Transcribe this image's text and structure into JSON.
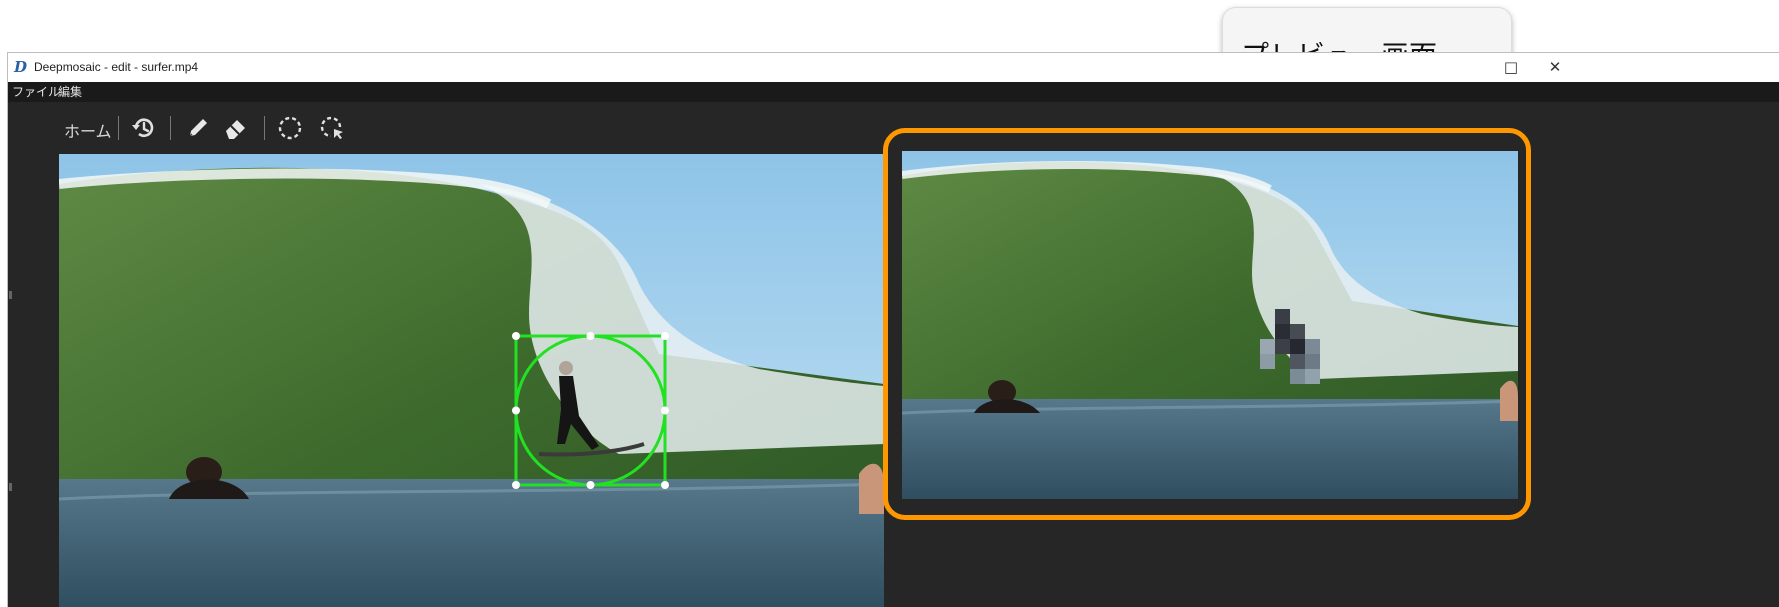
{
  "window": {
    "title": "Deepmosaic - edit - surfer.mp4",
    "logo_glyph": "D",
    "maximize_glyph": "□",
    "close_glyph": "✕"
  },
  "menu": {
    "items": [
      "ファイル",
      "編集"
    ]
  },
  "toolbar": {
    "home_label": "ホーム",
    "icons": [
      "history-icon",
      "pencil-icon",
      "eraser-icon",
      "lasso-select-icon",
      "lasso-pointer-select-icon"
    ]
  },
  "annotation": {
    "callout_text": "プレビュー画面"
  },
  "colors": {
    "app_background": "#262626",
    "menubar": "#1a1a1a",
    "selection_green": "#22e022",
    "highlight_orange": "#ff9800",
    "sky": "#a9d3ee",
    "wave_green": "#3e6a2a",
    "water": "#4c6e80"
  }
}
